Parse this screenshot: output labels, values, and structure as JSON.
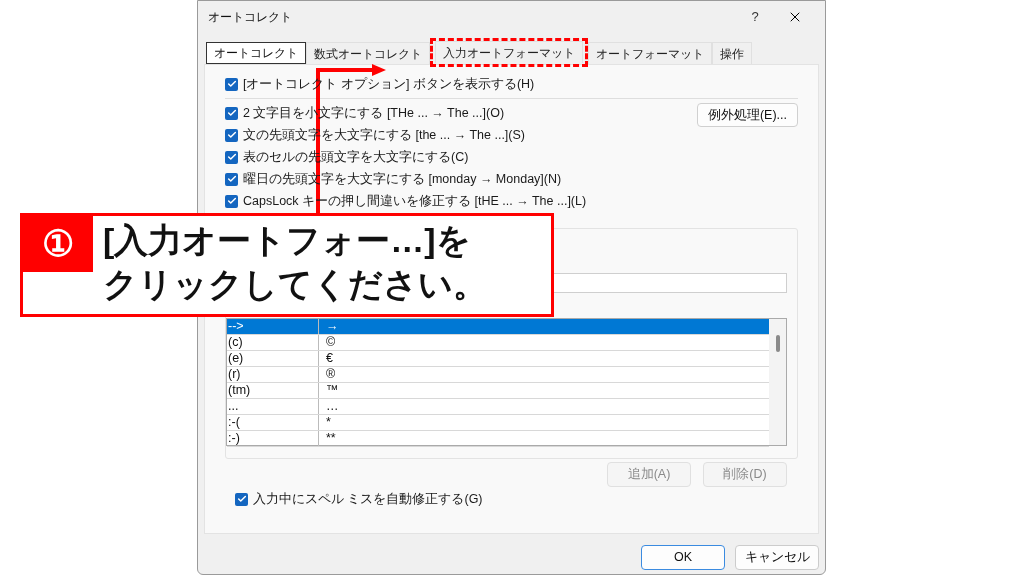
{
  "window": {
    "title": "オートコレクト",
    "help": "?"
  },
  "tabs": [
    {
      "label": "オートコレクト",
      "selected": true,
      "highlighted": false
    },
    {
      "label": "数式オートコレクト",
      "selected": false,
      "highlighted": false
    },
    {
      "label": "入力オートフォーマット",
      "selected": false,
      "highlighted": true
    },
    {
      "label": "オートフォーマット",
      "selected": false,
      "highlighted": false
    },
    {
      "label": "操作",
      "selected": false,
      "highlighted": false
    }
  ],
  "show_options_button": {
    "label": "[オートコレクト オプション] ボタンを表示する(H)",
    "checked": true
  },
  "options": [
    {
      "label": "2 文字目を小文字にする [THe ... → The ...](O)",
      "checked": true
    },
    {
      "label": "文の先頭文字を大文字にする [the ... → The ...](S)",
      "checked": true
    },
    {
      "label": "表のセルの先頭文字を大文字にする(C)",
      "checked": true
    },
    {
      "label": "曜日の先頭文字を大文字にする [monday →  Monday](N)",
      "checked": true
    },
    {
      "label": "CapsLock キーの押し間違いを修正する [tHE ... → The ...](L)",
      "checked": true
    }
  ],
  "exceptions_button": "例外処理(E)...",
  "replace": {
    "rows": [
      {
        "from": "-->",
        "to": "→",
        "selected": true
      },
      {
        "from": "(c)",
        "to": "©",
        "selected": false
      },
      {
        "from": "(e)",
        "to": "€",
        "selected": false
      },
      {
        "from": "(r)",
        "to": "®",
        "selected": false
      },
      {
        "from": "(tm)",
        "to": "™",
        "selected": false
      },
      {
        "from": "...",
        "to": "…",
        "selected": false
      },
      {
        "from": ":-(",
        "to": "*",
        "selected": false
      },
      {
        "from": ":-)",
        "to": "**",
        "selected": false
      }
    ],
    "add_button": {
      "label": "追加(A)",
      "disabled": true
    },
    "delete_button": {
      "label": "削除(D)",
      "disabled": true
    }
  },
  "spell_option": {
    "label": "入力中にスペル ミスを自動修正する(G)",
    "checked": true
  },
  "buttons": [
    {
      "label": "OK",
      "kind": "default"
    },
    {
      "label": "キャンセル",
      "kind": "normal"
    }
  ],
  "callout": {
    "number": "①",
    "lines": [
      "[入力オートフォー…]を",
      "クリックしてください。"
    ]
  }
}
